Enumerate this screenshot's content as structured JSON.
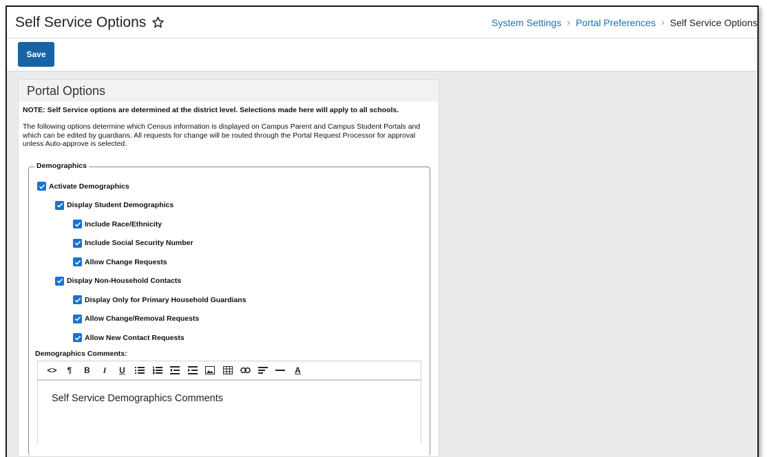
{
  "page": {
    "title": "Self Service Options",
    "breadcrumb": [
      "System Settings",
      "Portal Preferences",
      "Self Service Options"
    ]
  },
  "toolbar": {
    "save_label": "Save"
  },
  "panel": {
    "title": "Portal Options",
    "note": "NOTE: Self Service options are determined at the district level. Selections made here will apply to all schools.",
    "description": "The following options determine which Census information is displayed on Campus Parent and Campus Student Portals and which can be edited by guardians. All requests for change will be routed through the Portal Request Processor for approval unless Auto-approve is selected."
  },
  "demographics": {
    "legend": "Demographics",
    "checkboxes": [
      {
        "label": "Activate Demographics",
        "checked": true
      },
      {
        "label": "Display Student Demographics",
        "checked": true
      },
      {
        "label": "Include Race/Ethnicity",
        "checked": true
      },
      {
        "label": "Include Social Security Number",
        "checked": true
      },
      {
        "label": "Allow Change Requests",
        "checked": true
      },
      {
        "label": "Display Non-Household Contacts",
        "checked": true
      },
      {
        "label": "Display Only for Primary Household Guardians",
        "checked": true
      },
      {
        "label": "Allow Change/Removal Requests",
        "checked": true
      },
      {
        "label": "Allow New Contact Requests",
        "checked": true
      }
    ],
    "comments_label": "Demographics Comments:",
    "comments_text": "Self Service Demographics Comments"
  },
  "editor_toolbar": {
    "code": "<>",
    "paragraph": "¶",
    "bold": "B",
    "italic": "I",
    "underline": "U",
    "font_color": "A"
  },
  "colors": {
    "accent": "#1565a6",
    "link": "#1a6fb8",
    "checkbox": "#1a73d0"
  }
}
